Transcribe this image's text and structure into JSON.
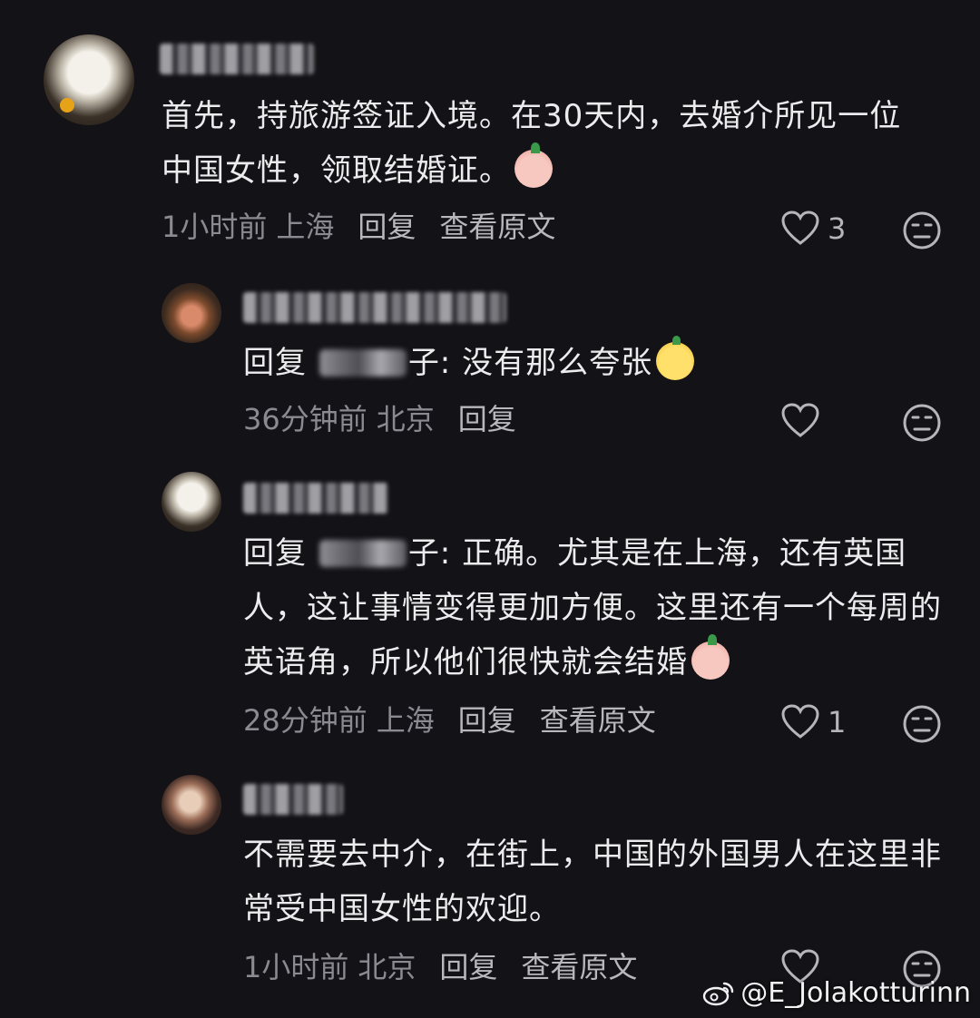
{
  "comments": [
    {
      "text": "首先，持旅游签证入境。在30天内，去婚介所见一位中国女性，领取结婚证。",
      "time": "1小时前",
      "location": "上海",
      "reply_label": "回复",
      "view_original_label": "查看原文",
      "likes": "3"
    },
    {
      "reply_prefix": "回复",
      "reply_to_suffix": "子:",
      "text": "没有那么夸张",
      "time": "36分钟前",
      "location": "北京",
      "reply_label": "回复",
      "likes": ""
    },
    {
      "reply_prefix": "回复",
      "reply_to_suffix": "子:",
      "text": "正确。尤其是在上海，还有英国人，这让事情变得更加方便。这里还有一个每周的英语角，所以他们很快就会结婚",
      "time": "28分钟前",
      "location": "上海",
      "reply_label": "回复",
      "view_original_label": "查看原文",
      "likes": "1"
    },
    {
      "text": "不需要去中介，在街上，中国的外国男人在这里非常受中国女性的欢迎。",
      "time": "1小时前",
      "location": "北京",
      "reply_label": "回复",
      "view_original_label": "查看原文",
      "likes": ""
    }
  ],
  "watermark": "@E_Jolakotturinn",
  "icons": {
    "like": "heart-outline-icon",
    "dislike": "meh-face-icon",
    "watermark": "weibo-logo-icon"
  },
  "colors": {
    "background": "#131216",
    "text": "#ececee",
    "meta": "#8a8a90"
  }
}
